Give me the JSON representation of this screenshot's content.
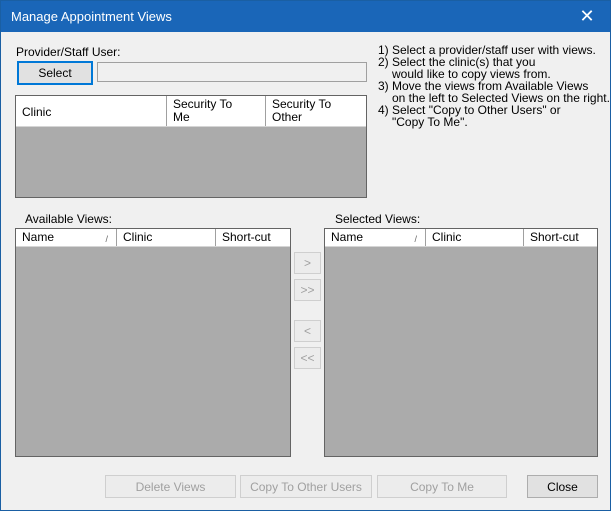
{
  "window": {
    "title": "Manage Appointment Views",
    "close_glyph": "✕"
  },
  "provider": {
    "label": "Provider/Staff User:",
    "select_label": "Select",
    "selected_value": ""
  },
  "clinic_grid": {
    "columns": [
      "Clinic",
      "Security To Me",
      "Security To Other"
    ],
    "rows": []
  },
  "instructions": [
    "1) Select a provider/staff user with views.",
    "2) Select the clinic(s) that you",
    "     would like to copy views from.",
    "3) Move the views from Available Views",
    "     on the left to Selected Views on the right.",
    "4) Select \"Copy to Other Users\" or",
    "     \"Copy To Me\"."
  ],
  "available_views": {
    "label": "Available Views:",
    "columns": [
      "Name",
      "Clinic",
      "Short-cut"
    ],
    "sort_glyph": "/",
    "rows": []
  },
  "selected_views": {
    "label": "Selected Views:",
    "columns": [
      "Name",
      "Clinic",
      "Short-cut"
    ],
    "sort_glyph": "/",
    "rows": []
  },
  "move_buttons": {
    "move_right": ">",
    "move_all_right": ">>",
    "move_left": "<",
    "move_all_left": "<<"
  },
  "footer": {
    "delete_views": "Delete Views",
    "copy_to_other_users": "Copy To Other Users",
    "copy_to_me": "Copy To Me",
    "close": "Close"
  },
  "colors": {
    "titlebar": "#1a66b8",
    "grid_body": "#ababab",
    "window_bg": "#f0f0f0"
  }
}
